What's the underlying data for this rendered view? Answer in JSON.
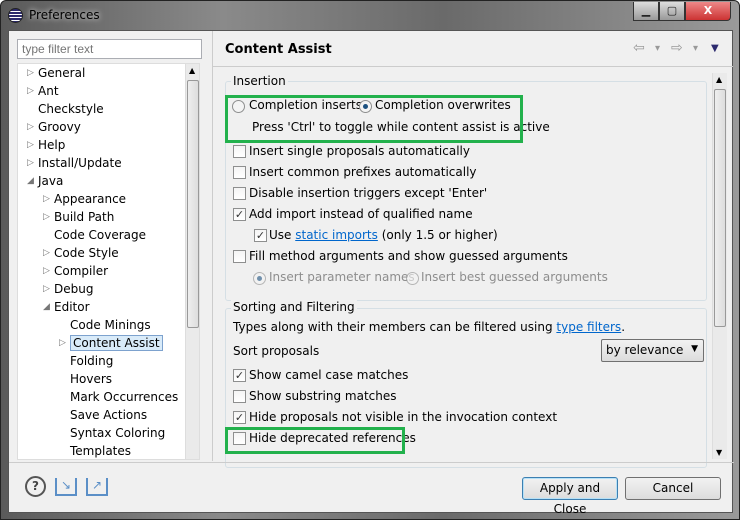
{
  "window": {
    "title": "Preferences",
    "minimize": "▁",
    "maximize": "▢",
    "close": "X"
  },
  "filter": {
    "placeholder": "type filter text"
  },
  "tree": [
    {
      "label": "General",
      "level": 0,
      "arrow": "collapsed"
    },
    {
      "label": "Ant",
      "level": 0,
      "arrow": "collapsed"
    },
    {
      "label": "Checkstyle",
      "level": 0,
      "arrow": "none"
    },
    {
      "label": "Groovy",
      "level": 0,
      "arrow": "collapsed"
    },
    {
      "label": "Help",
      "level": 0,
      "arrow": "collapsed"
    },
    {
      "label": "Install/Update",
      "level": 0,
      "arrow": "collapsed"
    },
    {
      "label": "Java",
      "level": 0,
      "arrow": "expanded"
    },
    {
      "label": "Appearance",
      "level": 1,
      "arrow": "collapsed"
    },
    {
      "label": "Build Path",
      "level": 1,
      "arrow": "collapsed"
    },
    {
      "label": "Code Coverage",
      "level": 1,
      "arrow": "none"
    },
    {
      "label": "Code Style",
      "level": 1,
      "arrow": "collapsed"
    },
    {
      "label": "Compiler",
      "level": 1,
      "arrow": "collapsed"
    },
    {
      "label": "Debug",
      "level": 1,
      "arrow": "collapsed"
    },
    {
      "label": "Editor",
      "level": 1,
      "arrow": "expanded"
    },
    {
      "label": "Code Minings",
      "level": 2,
      "arrow": "none"
    },
    {
      "label": "Content Assist",
      "level": 2,
      "arrow": "collapsed",
      "selected": true
    },
    {
      "label": "Folding",
      "level": 2,
      "arrow": "none"
    },
    {
      "label": "Hovers",
      "level": 2,
      "arrow": "none"
    },
    {
      "label": "Mark Occurrences",
      "level": 2,
      "arrow": "none"
    },
    {
      "label": "Save Actions",
      "level": 2,
      "arrow": "none"
    },
    {
      "label": "Syntax Coloring",
      "level": 2,
      "arrow": "none"
    },
    {
      "label": "Templates",
      "level": 2,
      "arrow": "none"
    }
  ],
  "page": {
    "title": "Content Assist",
    "nav": {
      "back": "⇦",
      "forward": "⇨",
      "menu": "▼",
      "dropdown": "▾"
    }
  },
  "insertion": {
    "label": "Insertion",
    "radio_inserts": "Completion inserts",
    "radio_overwrites": "Completion overwrites",
    "selected": "overwrites",
    "hint": "Press 'Ctrl' to toggle while content assist is active",
    "checks": [
      {
        "label": "Insert single proposals automatically",
        "checked": false
      },
      {
        "label": "Insert common prefixes automatically",
        "checked": false
      },
      {
        "label": "Disable insertion triggers except 'Enter'",
        "checked": false
      },
      {
        "label": "Add import instead of qualified name",
        "checked": true
      }
    ],
    "static_imports": {
      "pre": "Use ",
      "link": "static imports",
      "post": " (only 1.5 or higher)",
      "checked": true
    },
    "fill": {
      "label": "Fill method arguments and show guessed arguments",
      "checked": false
    },
    "param_names": "Insert parameter names",
    "best_guessed": "Insert best guessed arguments"
  },
  "sorting": {
    "label": "Sorting and Filtering",
    "text_pre": "Types along with their members can be filtered using ",
    "link": "type filters",
    "text_post": ".",
    "sort_label": "Sort proposals",
    "sort_value": "by relevance",
    "checks": [
      {
        "label": "Show camel case matches",
        "checked": true
      },
      {
        "label": "Show substring matches",
        "checked": false
      },
      {
        "label": "Hide proposals not visible in the invocation context",
        "checked": true
      },
      {
        "label": "Hide deprecated references",
        "checked": false
      }
    ]
  },
  "highlight_color": "#22b14c",
  "footer": {
    "apply_close": "Apply and Close",
    "cancel": "Cancel",
    "help": "?"
  }
}
